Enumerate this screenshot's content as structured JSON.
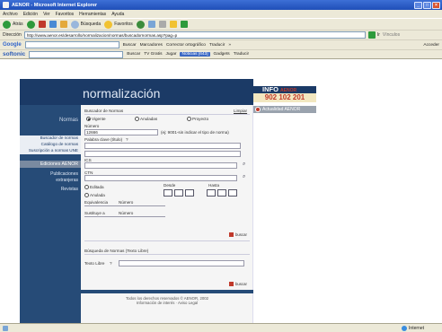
{
  "window": {
    "title": "AENOR - Microsoft Internet Explorer"
  },
  "menu": [
    "Archivo",
    "Edición",
    "Ver",
    "Favoritos",
    "Herramientas",
    "Ayuda"
  ],
  "toolbar": {
    "back": "Atrás",
    "search": "Búsqueda",
    "favorites": "Favoritos"
  },
  "address": {
    "label": "Dirección",
    "url": "http://www.aenor.es/desarrollo/normalizacion/normas/buscadornormas.asp?pag=p",
    "go": "Ir",
    "links": "Vínculos"
  },
  "google_bar": {
    "logo": "Google",
    "search": "Buscar",
    "bookmarks": "Marcadores",
    "spell": "Corrector ortográfico",
    "translate": "Traducir",
    "more": "»",
    "access": "Acceder"
  },
  "softonic_bar": {
    "logo": "softonic",
    "search": "Buscar",
    "tv": "TV Gratis",
    "play": "Jugar",
    "news": "Noticias [643]",
    "gadgets": "Gadgets",
    "translate": "Traducir"
  },
  "page": {
    "title": "normalización",
    "nav_heading": "Normas",
    "nav_items": {
      "active": "Buscador de normas",
      "catalog": "Catálogo de normas",
      "subscription": "Suscripción a normas UNE",
      "editions": "Ediciones AENOR",
      "publications": "Publicaciones",
      "outsourcing": "extranjeras",
      "journals": "Revistas"
    },
    "form": {
      "section_label": "Buscador de Normas",
      "help_link": "Limpiar",
      "radio_vigente": "Vigente",
      "radio_anuladas": "Anuladas",
      "radio_proyecto": "Proyecto",
      "number_label": "Número",
      "number_value": "12666",
      "number_hint": "(ej: 9001-sin indicar el tipo de norma)",
      "title_label": "Palabra clave (título)",
      "help_mark": "?",
      "ics_label": "ICS",
      "ctn_label": "CTN",
      "radio_editada": "Editada",
      "radio_anulada": "Anulada",
      "from_label": "Desde",
      "to_label": "Hasta",
      "equivalence_label": "Equivalencia",
      "equivalence_field": "Número",
      "substitutes_label": "Sustituye a",
      "substitutes_field": "Número",
      "search_button": "buscar",
      "section2_label": "Búsqueda de Normas (Texto Libre)",
      "free_text_label": "Texto Libre",
      "search_button2": "buscar",
      "footer_line1": "Todos los derechos reservados © AENOR, 2002",
      "footer_line2": "Información de interés · Aviso Legal"
    },
    "right_panel": {
      "info_title": "INFO",
      "info_brand": "AENOR",
      "phone": "902 102 201",
      "news": "Actualidad AENOR"
    }
  },
  "status": {
    "left": "",
    "zone": "Internet"
  },
  "colors": {
    "header_bg": "#1b3a66",
    "nav_bg": "#264b77",
    "accent": "#c0392b"
  }
}
